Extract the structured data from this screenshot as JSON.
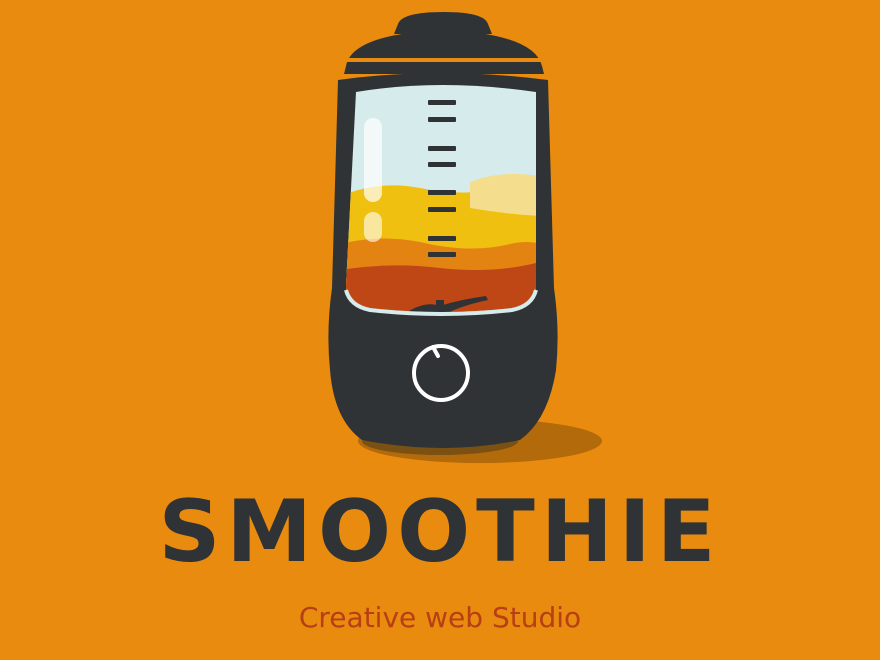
{
  "brand": {
    "name": "SMOOTHIE",
    "tagline": "Creative web Studio"
  },
  "colors": {
    "background": "#e98b0f",
    "body": "#2f3336",
    "glass": "#d6ebeb",
    "layer_yellow": "#f0c011",
    "layer_orange": "#e38412",
    "layer_red": "#bf4716",
    "tagline": "#b83e14",
    "shadow": "#b36a0a"
  },
  "illustration": {
    "subject": "blender-icon",
    "button": "power-button-icon"
  }
}
